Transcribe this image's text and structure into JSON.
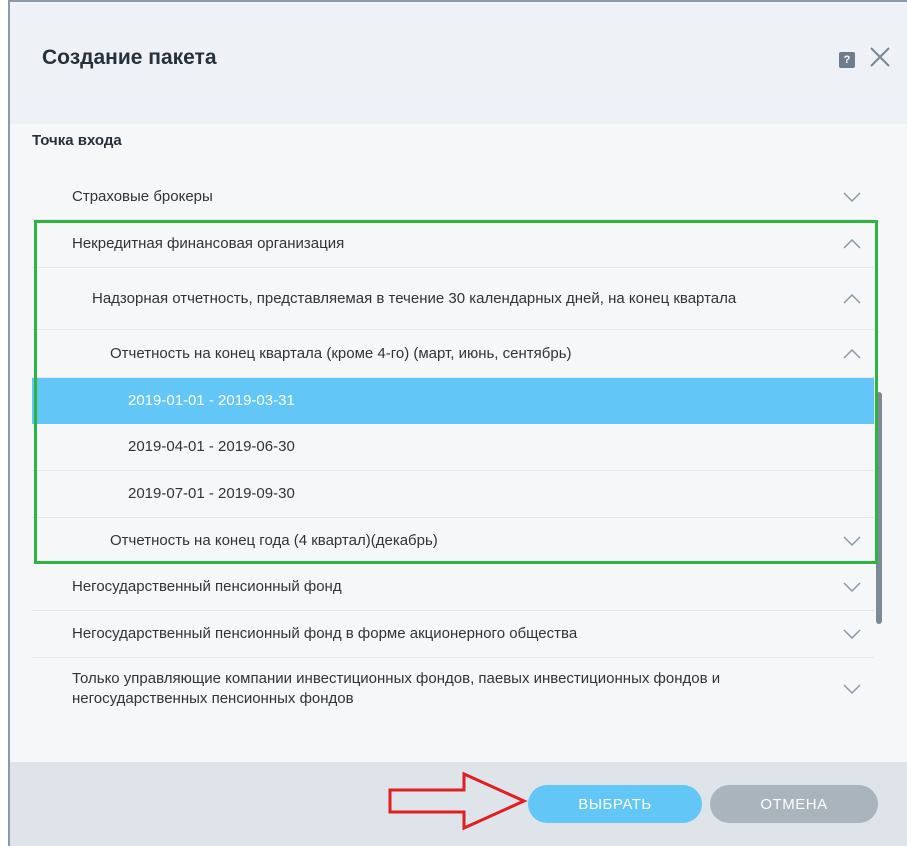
{
  "dialog": {
    "title": "Создание пакета",
    "help_icon": "question-icon",
    "close_icon": "close-icon"
  },
  "section": {
    "label": "Точка входа"
  },
  "tree": {
    "rows": [
      {
        "label": "Страховые брокеры",
        "state": "collapsed",
        "level": 1
      },
      {
        "label": "Некредитная финансовая организация",
        "state": "expanded",
        "level": 1
      },
      {
        "label": "Надзорная отчетность, представляемая в течение 30 календарных дней, на конец квартала",
        "state": "expanded",
        "level": 2
      },
      {
        "label": "Отчетность на конец квартала (кроме 4-го) (март, июнь, сентябрь)",
        "state": "expanded",
        "level": 3
      },
      {
        "label": "2019-01-01 - 2019-03-31",
        "state": "leaf",
        "level": 4,
        "selected": true
      },
      {
        "label": "2019-04-01 - 2019-06-30",
        "state": "leaf",
        "level": 4
      },
      {
        "label": "2019-07-01 - 2019-09-30",
        "state": "leaf",
        "level": 4
      },
      {
        "label": "Отчетность на конец года (4 квартал)(декабрь)",
        "state": "collapsed",
        "level": 3
      },
      {
        "label": "Негосударственный пенсионный фонд",
        "state": "collapsed",
        "level": 1
      },
      {
        "label": "Негосударственный пенсионный фонд в форме акционерного общества",
        "state": "collapsed",
        "level": 1
      },
      {
        "label": "Только управляющие компании инвестиционных фондов, паевых инвестиционных фондов и негосударственных пенсионных фондов",
        "state": "collapsed",
        "level": 1
      }
    ]
  },
  "footer": {
    "select_label": "ВЫБРАТЬ",
    "cancel_label": "ОТМЕНА"
  },
  "colors": {
    "selected_row": "#62c7f7",
    "highlight_border": "#2db542",
    "annotation_arrow": "#e02020",
    "cancel_button": "#aab4bd"
  }
}
